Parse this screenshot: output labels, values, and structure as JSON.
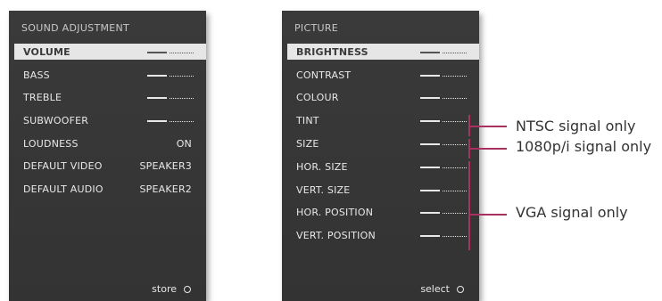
{
  "sound_menu": {
    "title": "SOUND ADJUSTMENT",
    "items": [
      {
        "label": "VOLUME",
        "type": "slider",
        "highlight": true
      },
      {
        "label": "BASS",
        "type": "slider"
      },
      {
        "label": "TREBLE",
        "type": "slider"
      },
      {
        "label": "SUBWOOFER",
        "type": "slider"
      },
      {
        "label": "LOUDNESS",
        "type": "value",
        "value": "ON"
      },
      {
        "label": "DEFAULT VIDEO",
        "type": "value",
        "value": "SPEAKER3"
      },
      {
        "label": "DEFAULT AUDIO",
        "type": "value",
        "value": "SPEAKER2"
      }
    ],
    "footer_label": "store"
  },
  "picture_menu": {
    "title": "PICTURE",
    "items": [
      {
        "label": "BRIGHTNESS",
        "type": "slider",
        "highlight": true
      },
      {
        "label": "CONTRAST",
        "type": "slider"
      },
      {
        "label": "COLOUR",
        "type": "slider"
      },
      {
        "label": "TINT",
        "type": "slider"
      },
      {
        "label": "SIZE",
        "type": "slider"
      },
      {
        "label": "HOR. SIZE",
        "type": "slider"
      },
      {
        "label": "VERT. SIZE",
        "type": "slider"
      },
      {
        "label": "HOR. POSITION",
        "type": "slider"
      },
      {
        "label": "VERT. POSITION",
        "type": "slider"
      }
    ],
    "footer_label": "select"
  },
  "annotations": {
    "ntsc": "NTSC signal only",
    "p1080": "1080p/i signal only",
    "vga": "VGA signal only",
    "color": "#a8315f"
  },
  "colors": {
    "menu_bg": "#3a3a3a",
    "highlight_bg": "#e6e6e6",
    "text": "#e8e8e8"
  }
}
